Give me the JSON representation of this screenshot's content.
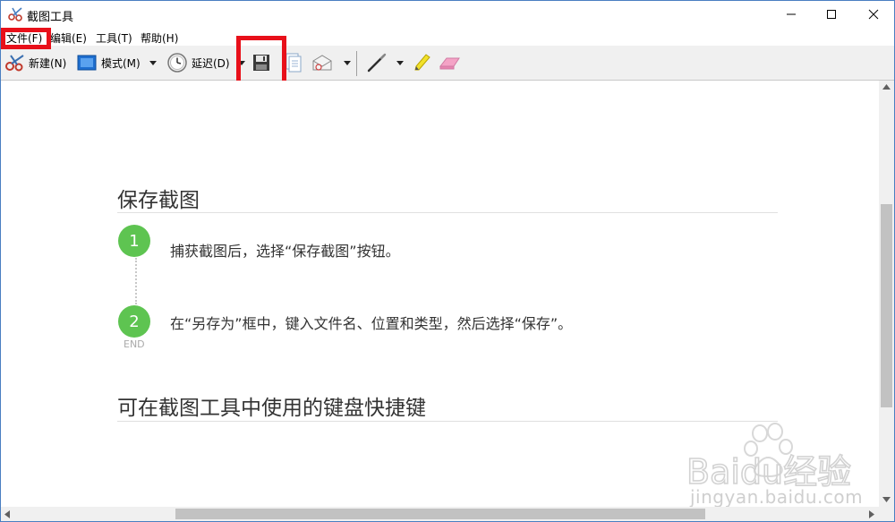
{
  "window": {
    "title": "截图工具"
  },
  "menu": [
    "文件(F)",
    "编辑(E)",
    "工具(T)",
    "帮助(H)"
  ],
  "toolbar": {
    "new_label": "新建(N)",
    "mode_label": "模式(M)",
    "delay_label": "延迟(D)"
  },
  "article": {
    "heading1": "保存截图",
    "steps": [
      {
        "num": "1",
        "text": "捕获截图后，选择“保存截图”按钮。"
      },
      {
        "num": "2",
        "text": "在“另存为”框中，键入文件名、位置和类型，然后选择“保存”。"
      }
    ],
    "end_label": "END",
    "heading2": "可在截图工具中使用的键盘快捷键"
  },
  "watermark": {
    "brand": "Baidu经验",
    "url": "jingyan.baidu.com"
  },
  "colors": {
    "highlight": "#e8101a",
    "step": "#5ec451",
    "pen_active": "#cce4f7"
  }
}
